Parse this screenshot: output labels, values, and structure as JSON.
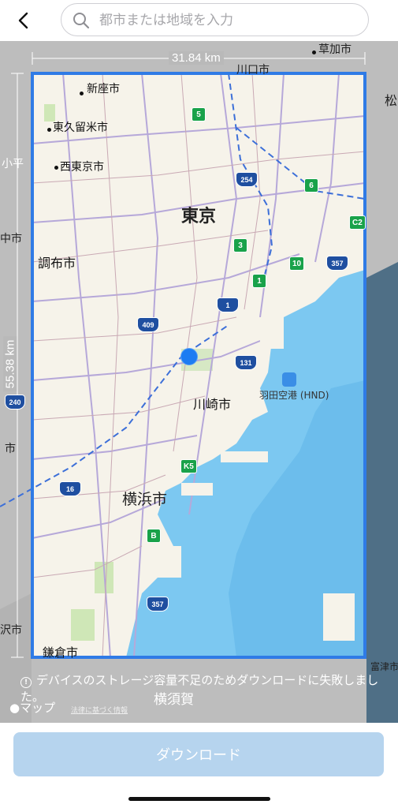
{
  "header": {
    "back_icon": "chevron-left-icon",
    "search_placeholder": "都市または地域を入力"
  },
  "map": {
    "width_label": "31.84 km",
    "height_label": "55.38 km",
    "cities": {
      "niiza": "新座市",
      "higashikurume": "東久留米市",
      "nishitokyo": "西東京市",
      "kodaira": "小平",
      "tokyo": "東京",
      "chofu": "調布市",
      "kawasaki": "川崎市",
      "yokohama": "横浜市",
      "kamakura": "鎌倉市",
      "yokosuka": "横須賀",
      "kawaguchi": "川口市",
      "soka": "草加市",
      "matsudo": "松",
      "futtsu": "富津市",
      "fujisawa": "沢市",
      "edge_shi": "中市",
      "edge_shi2": "市"
    },
    "airport": "羽田空港 (HND)",
    "route_shields": [
      "5",
      "6",
      "3",
      "1",
      "10",
      "K5",
      "B",
      "C2",
      "254",
      "409",
      "131",
      "357",
      "357",
      "16",
      "1",
      "240"
    ],
    "colors": {
      "water": "#7cc8f1",
      "land": "#f6f3ea",
      "frame": "#2f7be6",
      "shield_green": "#19a24a",
      "shield_blue": "#1f4fa0"
    }
  },
  "error": {
    "icon": "exclamation-circle-icon",
    "message": "デバイスのストレージ容量不足のためダウンロードに失敗しました。"
  },
  "attribution": {
    "maps_logo": "マップ",
    "legal": "法律に基づく情報"
  },
  "footer": {
    "download_label": "ダウンロード"
  }
}
